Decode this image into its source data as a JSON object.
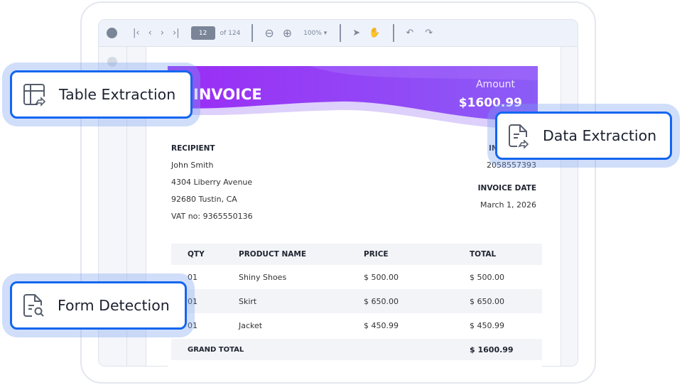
{
  "toolbar": {
    "current_page": "12",
    "page_total": "of 124",
    "zoom": "100%"
  },
  "invoice": {
    "title": "INVOICE",
    "amount_label": "Amount",
    "amount_value": "$1600.99",
    "recipient_label": "RECIPIENT",
    "recipient_name": "John Smith",
    "address1": "4304 Liberry Avenue",
    "address2": "92680 Tustin, CA",
    "vat": "VAT no: 9365550136",
    "number_label": "IN",
    "number_value": "2058557393",
    "date_label": "INVOICE DATE",
    "date_value": "March 1, 2026"
  },
  "table": {
    "headers": [
      "QTY",
      "PRODUCT NAME",
      "PRICE",
      "TOTAL"
    ],
    "rows": [
      [
        "01",
        "Shiny Shoes",
        "$ 500.00",
        "$ 500.00"
      ],
      [
        "01",
        "Skirt",
        "$ 650.00",
        "$ 650.00"
      ],
      [
        "01",
        "Jacket",
        "$ 450.99",
        "$ 450.99"
      ]
    ],
    "grand_total_label": "GRAND TOTAL",
    "grand_total_value": "$ 1600.99"
  },
  "callouts": {
    "table": "Table Extraction",
    "data": "Data Extraction",
    "form": "Form Detection"
  },
  "colors": {
    "accent": "#1366f0",
    "gradient_start": "#9b2cf5",
    "gradient_end": "#8b5cf6"
  }
}
